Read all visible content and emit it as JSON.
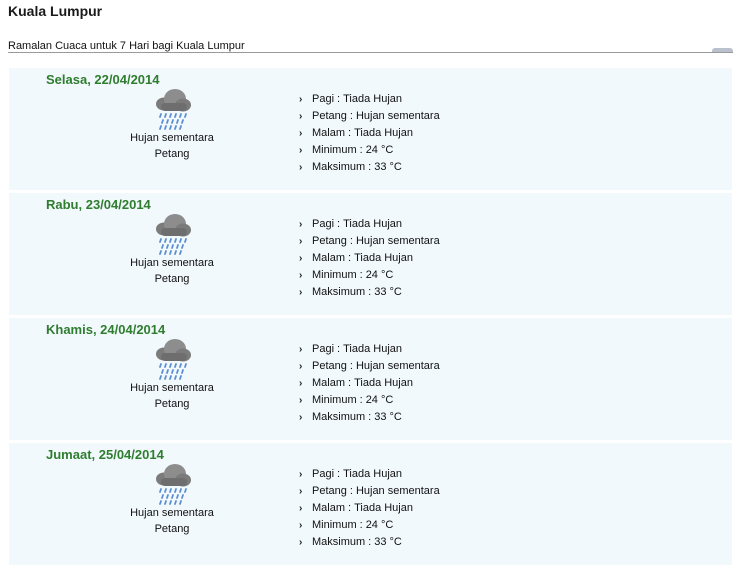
{
  "header": {
    "city": "Kuala Lumpur",
    "subtitle": "Ramalan Cuaca untuk 7 Hari bagi Kuala Lumpur"
  },
  "days": [
    {
      "date": "Selasa, 22/04/2014",
      "icon": "rain-cloud-icon",
      "caption": [
        "Hujan sementara",
        "Petang"
      ],
      "details": [
        {
          "label": "Pagi",
          "value": "Tiada Hujan"
        },
        {
          "label": "Petang",
          "value": "Hujan sementara"
        },
        {
          "label": "Malam",
          "value": "Tiada Hujan"
        },
        {
          "label": "Minimum",
          "value": "24 °C"
        },
        {
          "label": "Maksimum",
          "value": "33 °C"
        }
      ]
    },
    {
      "date": "Rabu, 23/04/2014",
      "icon": "rain-cloud-icon",
      "caption": [
        "Hujan sementara",
        "Petang"
      ],
      "details": [
        {
          "label": "Pagi",
          "value": "Tiada Hujan"
        },
        {
          "label": "Petang",
          "value": "Hujan sementara"
        },
        {
          "label": "Malam",
          "value": "Tiada Hujan"
        },
        {
          "label": "Minimum",
          "value": "24 °C"
        },
        {
          "label": "Maksimum",
          "value": "33 °C"
        }
      ]
    },
    {
      "date": "Khamis, 24/04/2014",
      "icon": "rain-cloud-icon",
      "caption": [
        "Hujan sementara",
        "Petang"
      ],
      "details": [
        {
          "label": "Pagi",
          "value": "Tiada Hujan"
        },
        {
          "label": "Petang",
          "value": "Hujan sementara"
        },
        {
          "label": "Malam",
          "value": "Tiada Hujan"
        },
        {
          "label": "Minimum",
          "value": "24 °C"
        },
        {
          "label": "Maksimum",
          "value": "33 °C"
        }
      ]
    },
    {
      "date": "Jumaat, 25/04/2014",
      "icon": "rain-cloud-icon",
      "caption": [
        "Hujan sementara",
        "Petang"
      ],
      "details": [
        {
          "label": "Pagi",
          "value": "Tiada Hujan"
        },
        {
          "label": "Petang",
          "value": "Hujan sementara"
        },
        {
          "label": "Malam",
          "value": "Tiada Hujan"
        },
        {
          "label": "Minimum",
          "value": "24 °C"
        },
        {
          "label": "Maksimum",
          "value": "33 °C"
        }
      ]
    }
  ],
  "colors": {
    "day_title": "#2f7d2f",
    "card_background": "#f2f9fd"
  }
}
